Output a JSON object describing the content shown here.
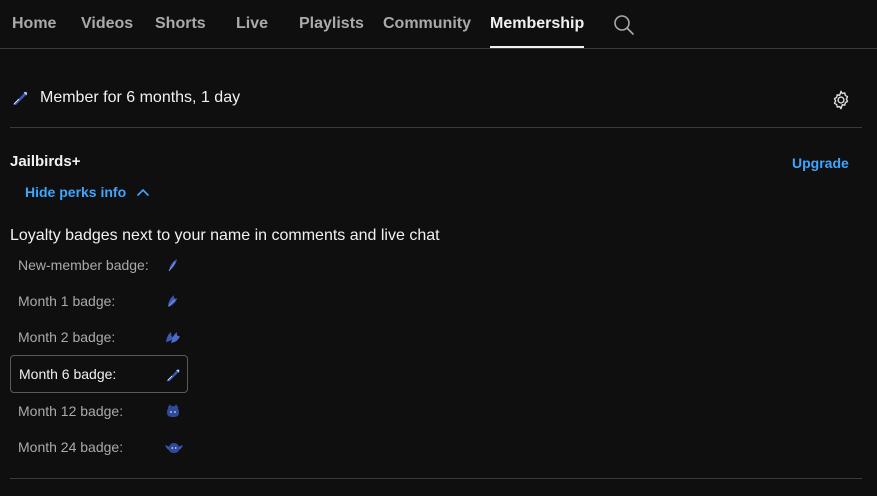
{
  "tabs": {
    "home": "Home",
    "videos": "Videos",
    "shorts": "Shorts",
    "live": "Live",
    "playlists": "Playlists",
    "community": "Community",
    "membership": "Membership",
    "active": "Membership"
  },
  "membership": {
    "status": "Member for 6 months, 1 day",
    "tier_name": "Jailbirds+",
    "upgrade_label": "Upgrade",
    "hide_perks_label": "Hide perks info",
    "perk_heading": "Loyalty badges next to your name in comments and live chat",
    "badges": [
      {
        "label": "New-member badge:",
        "icon": "feather-badge-icon"
      },
      {
        "label": "Month 1 badge:",
        "icon": "wing-badge-icon"
      },
      {
        "label": "Month 2 badge:",
        "icon": "double-wing-badge-icon"
      },
      {
        "label": "Month 6 badge:",
        "icon": "quill-badge-icon",
        "selected": true
      },
      {
        "label": "Month 12 badge:",
        "icon": "bird-face-badge-icon"
      },
      {
        "label": "Month 24 badge:",
        "icon": "winged-bird-badge-icon"
      }
    ]
  },
  "colors": {
    "background": "#0f0f0f",
    "accent": "#3ea6ff",
    "text_primary": "#f1f1f1",
    "text_secondary": "#aaaaaa",
    "badge_blue": "#3b5bb5"
  }
}
